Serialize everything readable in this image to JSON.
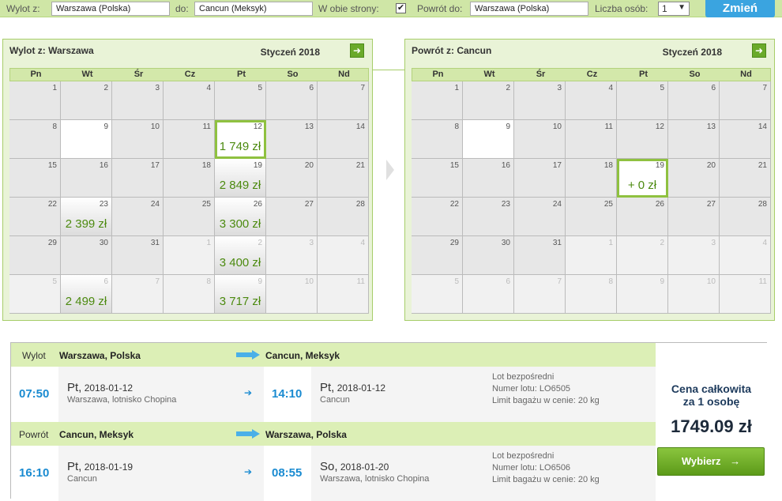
{
  "search": {
    "from_label": "Wylot z:",
    "from_value": "Warszawa (Polska)",
    "to_label": "do:",
    "to_value": "Cancun (Meksyk)",
    "roundtrip_label": "W obie strony:",
    "roundtrip_checked": "✔",
    "return_label": "Powrót do:",
    "return_value": "Warszawa (Polska)",
    "persons_label": "Liczba osób:",
    "persons_value": "1",
    "submit_label": "Zmień"
  },
  "weekdays": [
    "Pn",
    "Wt",
    "Śr",
    "Cz",
    "Pt",
    "So",
    "Nd"
  ],
  "outbound": {
    "title": "Wylot z: Warszawa",
    "month": "Styczeń 2018",
    "days": [
      {
        "n": "1"
      },
      {
        "n": "2"
      },
      {
        "n": "3"
      },
      {
        "n": "4"
      },
      {
        "n": "5"
      },
      {
        "n": "6"
      },
      {
        "n": "7"
      },
      {
        "n": "8"
      },
      {
        "n": "9",
        "blank": true
      },
      {
        "n": "10"
      },
      {
        "n": "11"
      },
      {
        "n": "12",
        "price": "1 749 zł",
        "selected": true
      },
      {
        "n": "13"
      },
      {
        "n": "14"
      },
      {
        "n": "15"
      },
      {
        "n": "16"
      },
      {
        "n": "17"
      },
      {
        "n": "18"
      },
      {
        "n": "19",
        "price": "2 849 zł"
      },
      {
        "n": "20"
      },
      {
        "n": "21"
      },
      {
        "n": "22"
      },
      {
        "n": "23",
        "price": "2 399 zł"
      },
      {
        "n": "24"
      },
      {
        "n": "25"
      },
      {
        "n": "26",
        "price": "3 300 zł"
      },
      {
        "n": "27"
      },
      {
        "n": "28"
      },
      {
        "n": "29"
      },
      {
        "n": "30"
      },
      {
        "n": "31"
      },
      {
        "n": "1",
        "other": true
      },
      {
        "n": "2",
        "other": true,
        "price": "3 400 zł"
      },
      {
        "n": "3",
        "other": true
      },
      {
        "n": "4",
        "other": true
      },
      {
        "n": "5",
        "other": true
      },
      {
        "n": "6",
        "other": true,
        "price": "2 499 zł"
      },
      {
        "n": "7",
        "other": true
      },
      {
        "n": "8",
        "other": true
      },
      {
        "n": "9",
        "other": true,
        "price": "3 717 zł"
      },
      {
        "n": "10",
        "other": true
      },
      {
        "n": "11",
        "other": true
      }
    ]
  },
  "return": {
    "title": "Powrót z: Cancun",
    "month": "Styczeń 2018",
    "days": [
      {
        "n": "1"
      },
      {
        "n": "2"
      },
      {
        "n": "3"
      },
      {
        "n": "4"
      },
      {
        "n": "5"
      },
      {
        "n": "6"
      },
      {
        "n": "7"
      },
      {
        "n": "8"
      },
      {
        "n": "9",
        "blank": true
      },
      {
        "n": "10"
      },
      {
        "n": "11"
      },
      {
        "n": "12"
      },
      {
        "n": "13"
      },
      {
        "n": "14"
      },
      {
        "n": "15"
      },
      {
        "n": "16"
      },
      {
        "n": "17"
      },
      {
        "n": "18"
      },
      {
        "n": "19",
        "price": "+ 0 zł",
        "selected": true
      },
      {
        "n": "20"
      },
      {
        "n": "21"
      },
      {
        "n": "22"
      },
      {
        "n": "23"
      },
      {
        "n": "24"
      },
      {
        "n": "25"
      },
      {
        "n": "26"
      },
      {
        "n": "27"
      },
      {
        "n": "28"
      },
      {
        "n": "29"
      },
      {
        "n": "30"
      },
      {
        "n": "31"
      },
      {
        "n": "1",
        "other": true
      },
      {
        "n": "2",
        "other": true
      },
      {
        "n": "3",
        "other": true
      },
      {
        "n": "4",
        "other": true
      },
      {
        "n": "5",
        "other": true
      },
      {
        "n": "6",
        "other": true
      },
      {
        "n": "7",
        "other": true
      },
      {
        "n": "8",
        "other": true
      },
      {
        "n": "9",
        "other": true
      },
      {
        "n": "10",
        "other": true
      },
      {
        "n": "11",
        "other": true
      }
    ]
  },
  "summary": {
    "outbound": {
      "kind": "Wylot",
      "from": "Warszawa, Polska",
      "to": "Cancun, Meksyk",
      "dep_time": "07:50",
      "dep_day": "Pt,",
      "dep_date": "2018-01-12",
      "dep_airport": "Warszawa, lotnisko Chopina",
      "arr_time": "14:10",
      "arr_day": "Pt,",
      "arr_date": "2018-01-12",
      "arr_airport": "Cancun",
      "info1": "Lot bezpośredni",
      "info2": "Numer lotu: LO6505",
      "info3": "Limit bagażu w cenie: 20 kg"
    },
    "return": {
      "kind": "Powrót",
      "from": "Cancun, Meksyk",
      "to": "Warszawa, Polska",
      "dep_time": "16:10",
      "dep_day": "Pt,",
      "dep_date": "2018-01-19",
      "dep_airport": "Cancun",
      "arr_time": "08:55",
      "arr_day": "So,",
      "arr_date": "2018-01-20",
      "arr_airport": "Warszawa, lotnisko Chopina",
      "info1": "Lot bezpośredni",
      "info2": "Numer lotu: LO6506",
      "info3": "Limit bagażu w cenie: 20 kg"
    },
    "total_label_1": "Cena całkowita",
    "total_label_2": "za 1 osobę",
    "total_value": "1749.09 zł",
    "choose_label": "Wybierz",
    "choose_icon": "→"
  },
  "icons": {
    "next_month": "➜",
    "small_arrow": "➔"
  },
  "colors": {
    "accent_green": "#8fc140",
    "price_green": "#4c8a10",
    "time_blue": "#1a8bd1",
    "button_blue": "#3aa4e0"
  }
}
